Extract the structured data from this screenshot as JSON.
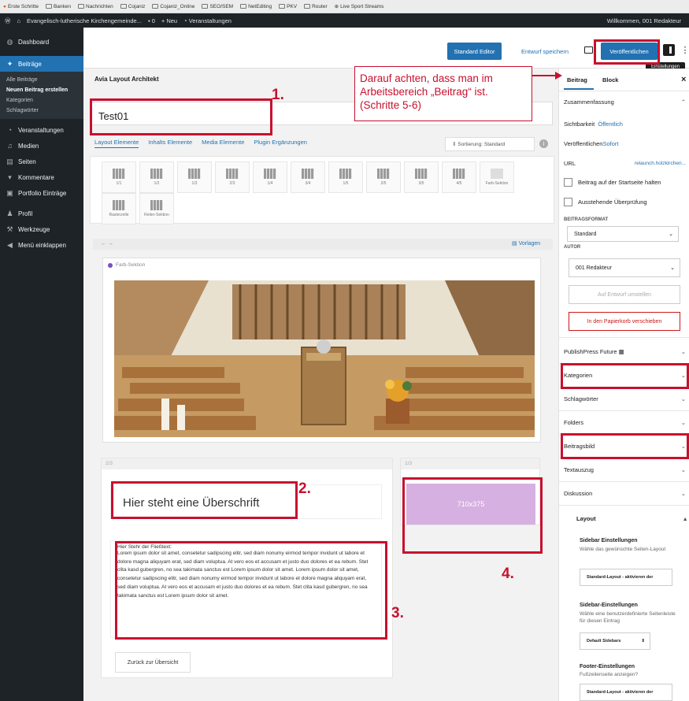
{
  "bookmarks": [
    "Erste Schritte",
    "Banken",
    "Nachrichten",
    "Cojaniz",
    "Cojaniz_Online",
    "SEO/SEM",
    "NetEditing",
    "PKV",
    "Router",
    "Live Sport Streams"
  ],
  "adminbar": {
    "site": "Evangelisch-lutherische Kirchengemeinde...",
    "comments": "0",
    "new": "+ Neu",
    "events": "Veranstaltungen",
    "welcome": "Willkommen, 001 Redakteur"
  },
  "sidebar": {
    "dashboard": "Dashboard",
    "posts": "Beiträge",
    "sub": [
      "Alle Beiträge",
      "Neuen Beitrag erstellen",
      "Kategorien",
      "Schlagwörter"
    ],
    "items": [
      "Veranstaltungen",
      "Medien",
      "Seiten",
      "Kommentare",
      "Portfolio Einträge",
      "Profil",
      "Werkzeuge",
      "Menü einklappen"
    ]
  },
  "toolbar": {
    "std_editor": "Standard Editor",
    "draft": "Entwurf speichern",
    "publish": "Veröffentlichen",
    "tooltip": "Einstellungen"
  },
  "editor": {
    "title": "Avia Layout Architekt",
    "post_title": "Test01",
    "tabs": [
      "Layout Elemente",
      "Inhalts Elemente",
      "Media Elemente",
      "Plugin Ergänzungen"
    ],
    "sort": "Sortierung: Standard",
    "elements": [
      "1/1",
      "1/2",
      "1/3",
      "2/3",
      "1/4",
      "3/4",
      "1/5",
      "2/5",
      "3/5",
      "4/5",
      "Farb-Sektion",
      "Rasterzelle",
      "Reiter-Sektion"
    ],
    "canvas_nav": "← →",
    "templates": "Vorlagen",
    "section_label": "Farb-Sektion",
    "col_a": "2/3",
    "col_b": "1/3",
    "heading": "Hier steht eine Überschrift",
    "text_title": "Hier Stehr der Fließtext:",
    "text_body": "Lorem ipsum dolor sit amet, consetetur sadipscing elitr, sed diam nonumy eirmod tempor invidunt ut labore et dolore magna aliquyam erat, sed diam voluptua. At vero eos et accusam et justo duo dolores et ea rebum. Stet clita kasd gubergren, no sea takimata sanctus est Lorem ipsum dolor sit amet. Lorem ipsum dolor sit amet, consetetur sadipscing elitr, sed diam nonumy eirmod tempor invidunt ut labore et dolore magna aliquyam erat, sed diam voluptua. At vero eos et accusam et justo duo dolores et ea rebum. Stet clita kasd gubergren, no sea takimata sanctus est Lorem ipsum dolor sit amet.",
    "back": "Zurück zur Übersicht",
    "img_placeholder": "710x375"
  },
  "panel": {
    "tab_post": "Beitrag",
    "tab_block": "Block",
    "close": "×",
    "summary": "Zusammenfassung",
    "visibility": "Sichtbarkeit",
    "visibility_val": "Öffentlich",
    "published": "Veröffentlichen",
    "published_val": "Sofort",
    "url": "URL",
    "url_val": "relaunch.holzkirchen...",
    "sticky": "Beitrag auf der Startseite halten",
    "pending": "Ausstehende Überprüfung",
    "format_label": "BEITRAGSFORMAT",
    "format_val": "Standard",
    "author_label": "AUTOR",
    "author_val": "001 Redakteur",
    "to_draft": "Auf Entwurf umstellen",
    "trash": "In den Papierkorb verschieben",
    "sections": [
      "PublishPress Future",
      "Kategorien",
      "Schlagwörter",
      "Folders",
      "Beitragsbild",
      "Textauszug",
      "Diskussion"
    ],
    "layout": "Layout",
    "sb1_title": "Sidebar Einstellungen",
    "sb1_desc": "Wähle das gewünschte Seiten-Layout",
    "sb1_val": "Standard-Layout - aktivieren der",
    "sb2_title": "Sidebar-Einstellungen",
    "sb2_desc": "Wähle eine benutzerdefinierte Seitenleiste für diesen Eintrag",
    "sb2_val": "Default Sidebars",
    "ft_title": "Footer-Einstellungen",
    "ft_desc": "Fußzeilenseite anzeigen?",
    "ft_val": "Standard-Layout - aktivieren der"
  },
  "annotations": {
    "note": "Darauf achten, dass man im Arbeitsbereich „Beitrag“ ist. (Schritte 5-6)",
    "n1": "1.",
    "n2": "2.",
    "n3": "3.",
    "n4": "4."
  },
  "colors": {
    "accent": "#2271b1",
    "callout": "#c8102e",
    "admin": "#1d2327",
    "placeholder": "#d6b0e0"
  }
}
